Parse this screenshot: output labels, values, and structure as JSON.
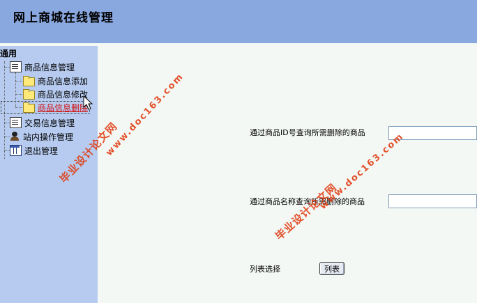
{
  "app": {
    "title": "网上商城在线管理"
  },
  "sidebar": {
    "root": "通用",
    "items": [
      {
        "label": "商品信息管理",
        "icon": "document-edit-icon"
      },
      {
        "label": "商品信息添加",
        "icon": "folder-icon"
      },
      {
        "label": "商品信息修改",
        "icon": "folder-icon"
      },
      {
        "label": "商品信息删除",
        "icon": "folder-icon",
        "selected": true
      },
      {
        "label": "交易信息管理",
        "icon": "document-icon"
      },
      {
        "label": "站内操作管理",
        "icon": "person-icon"
      },
      {
        "label": "退出管理",
        "icon": "grid-icon"
      }
    ]
  },
  "form": {
    "id_query_label": "通过商品ID号查询所需删除的商品",
    "id_query_value": "",
    "name_query_label": "通过商品名称查询所需删除的商品",
    "name_query_value": "",
    "list_label": "列表选择",
    "list_button": "列表"
  },
  "watermarks": {
    "text": "毕业设计论文网",
    "url": "www.doc163.com"
  },
  "colors": {
    "header": "#8aa8e0",
    "sidebar": "#b6cbef",
    "selected_link": "#d01010",
    "watermark": "#e03a10"
  }
}
